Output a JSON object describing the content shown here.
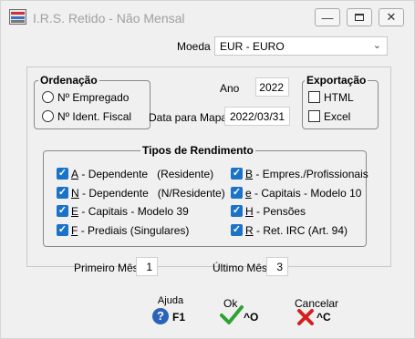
{
  "window": {
    "title": "I.R.S. Retido - Não Mensal"
  },
  "moeda": {
    "label": "Moeda",
    "value": "EUR - EURO"
  },
  "ordenacao": {
    "title": "Ordenação",
    "options": [
      {
        "label": "Nº Empregado",
        "selected": false
      },
      {
        "label": "Nº Ident. Fiscal",
        "selected": false
      }
    ]
  },
  "ano": {
    "label": "Ano",
    "value": "2022"
  },
  "data_mapa": {
    "label": "Data para Mapa",
    "value": "2022/03/31"
  },
  "exportacao": {
    "title": "Exportação",
    "options": [
      {
        "label": "HTML",
        "checked": false
      },
      {
        "label": "Excel",
        "checked": false
      }
    ]
  },
  "tipos": {
    "title": "Tipos de Rendimento",
    "left": [
      {
        "code": "A",
        "label": "- Dependente   (Residente)",
        "checked": true
      },
      {
        "code": "N",
        "label": "- Dependente   (N/Residente)",
        "checked": true
      },
      {
        "code": "E",
        "label": "- Capitais - Modelo 39",
        "checked": true
      },
      {
        "code": "F",
        "label": "- Prediais (Singulares)",
        "checked": true
      }
    ],
    "right": [
      {
        "code": "B",
        "label": "- Empres./Profissionais",
        "checked": true
      },
      {
        "code": "e",
        "label": "- Capitais - Modelo 10",
        "checked": true
      },
      {
        "code": "H",
        "label": "- Pensões",
        "checked": true
      },
      {
        "code": "R",
        "label": "- Ret. IRC (Art. 94)",
        "checked": true
      }
    ]
  },
  "primeiro_mes": {
    "label": "Primeiro Mês",
    "value": "1"
  },
  "ultimo_mes": {
    "label": "Último Mês",
    "value": "3"
  },
  "buttons": {
    "ajuda": {
      "label": "Ajuda",
      "key": "F1"
    },
    "ok": {
      "label": "Ok",
      "key": "^O"
    },
    "cancelar": {
      "label": "Cancelar",
      "key": "^C"
    }
  },
  "colors": {
    "check_blue": "#1a73c9",
    "ok_green": "#2fa32f",
    "cancel_red": "#d42020",
    "help_blue": "#2b63b8"
  }
}
